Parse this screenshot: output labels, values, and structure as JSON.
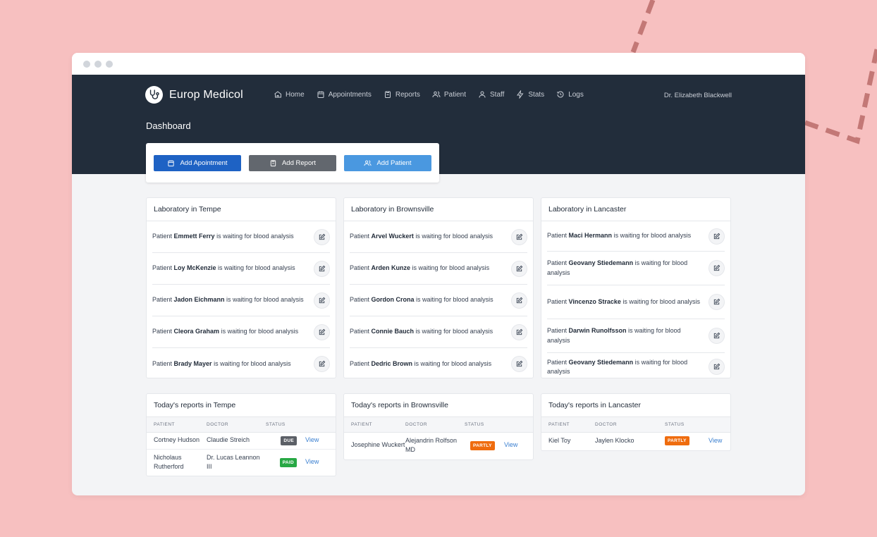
{
  "app": {
    "brand": "Europ Medicol",
    "user": "Dr. Elizabeth Blackwell",
    "page_title": "Dashboard"
  },
  "nav": [
    {
      "label": "Home",
      "icon": "home-icon"
    },
    {
      "label": "Appointments",
      "icon": "calendar-icon"
    },
    {
      "label": "Reports",
      "icon": "clipboard-icon"
    },
    {
      "label": "Patient",
      "icon": "users-icon"
    },
    {
      "label": "Staff",
      "icon": "user-icon"
    },
    {
      "label": "Stats",
      "icon": "bolt-icon"
    },
    {
      "label": "Logs",
      "icon": "history-icon"
    }
  ],
  "actions": {
    "add_appointment": "Add Apointment",
    "add_report": "Add Report",
    "add_patient": "Add Patient"
  },
  "labs": [
    {
      "title": "Laboratory in Tempe",
      "rows": [
        {
          "prefix": "Patient ",
          "name": "Emmett Ferry",
          "suffix": " is waiting for blood analysis"
        },
        {
          "prefix": "Patient ",
          "name": "Loy McKenzie",
          "suffix": " is waiting for blood analysis"
        },
        {
          "prefix": "Patient ",
          "name": "Jadon Eichmann",
          "suffix": " is waiting for blood analysis"
        },
        {
          "prefix": "Patient ",
          "name": "Cleora Graham",
          "suffix": " is waiting for blood analysis"
        },
        {
          "prefix": "Patient ",
          "name": "Brady Mayer",
          "suffix": " is waiting for blood analysis"
        }
      ]
    },
    {
      "title": "Laboratory in Brownsville",
      "rows": [
        {
          "prefix": "Patient ",
          "name": "Arvel Wuckert",
          "suffix": " is waiting for blood analysis"
        },
        {
          "prefix": "Patient ",
          "name": "Arden Kunze",
          "suffix": " is waiting for blood analysis"
        },
        {
          "prefix": "Patient ",
          "name": "Gordon Crona",
          "suffix": " is waiting for blood analysis"
        },
        {
          "prefix": "Patient ",
          "name": "Connie Bauch",
          "suffix": " is waiting for blood analysis"
        },
        {
          "prefix": "Patient ",
          "name": "Dedric Brown",
          "suffix": " is waiting for blood analysis"
        }
      ]
    },
    {
      "title": "Laboratory in Lancaster",
      "rows": [
        {
          "prefix": "Patient ",
          "name": "Maci Hermann",
          "suffix": " is waiting for blood analysis"
        },
        {
          "prefix": "Patient ",
          "name": "Geovany Stiedemann",
          "suffix": " is waiting for blood analysis"
        },
        {
          "prefix": "Patient ",
          "name": "Vincenzo Stracke",
          "suffix": " is waiting for blood analysis"
        },
        {
          "prefix": "Patient ",
          "name": "Darwin Runolfsson",
          "suffix": " is waiting for blood analysis"
        },
        {
          "prefix": "Patient ",
          "name": "Geovany Stiedemann",
          "suffix": " is waiting for blood analysis"
        }
      ]
    }
  ],
  "reports": [
    {
      "title": "Today's reports in Tempe",
      "rows": [
        {
          "patient": "Cortney Hudson",
          "doctor": "Claudie Streich",
          "status": "DUE",
          "link": "View"
        },
        {
          "patient": "Nicholaus Rutherford",
          "doctor": "Dr. Lucas Leannon III",
          "status": "PAID",
          "link": "View"
        }
      ]
    },
    {
      "title": "Today's reports in Brownsville",
      "rows": [
        {
          "patient": "Josephine Wuckert",
          "doctor": "Alejandrin Rolfson MD",
          "status": "PARTLY",
          "link": "View"
        }
      ]
    },
    {
      "title": "Today's reports in Lancaster",
      "rows": [
        {
          "patient": "Kiel Toy",
          "doctor": "Jaylen Klocko",
          "status": "PARTLY",
          "link": "View"
        }
      ]
    }
  ],
  "report_headers": {
    "patient": "PATIENT",
    "doctor": "DOCTOR",
    "status": "STATUS"
  },
  "colors": {
    "background": "#f7c0c0",
    "nav": "#222d3b",
    "primary": "#1e62c4",
    "secondary": "#62676e",
    "info": "#4a98e0",
    "paid": "#27a844",
    "due": "#5b5f66",
    "partly": "#ef6c0e"
  }
}
